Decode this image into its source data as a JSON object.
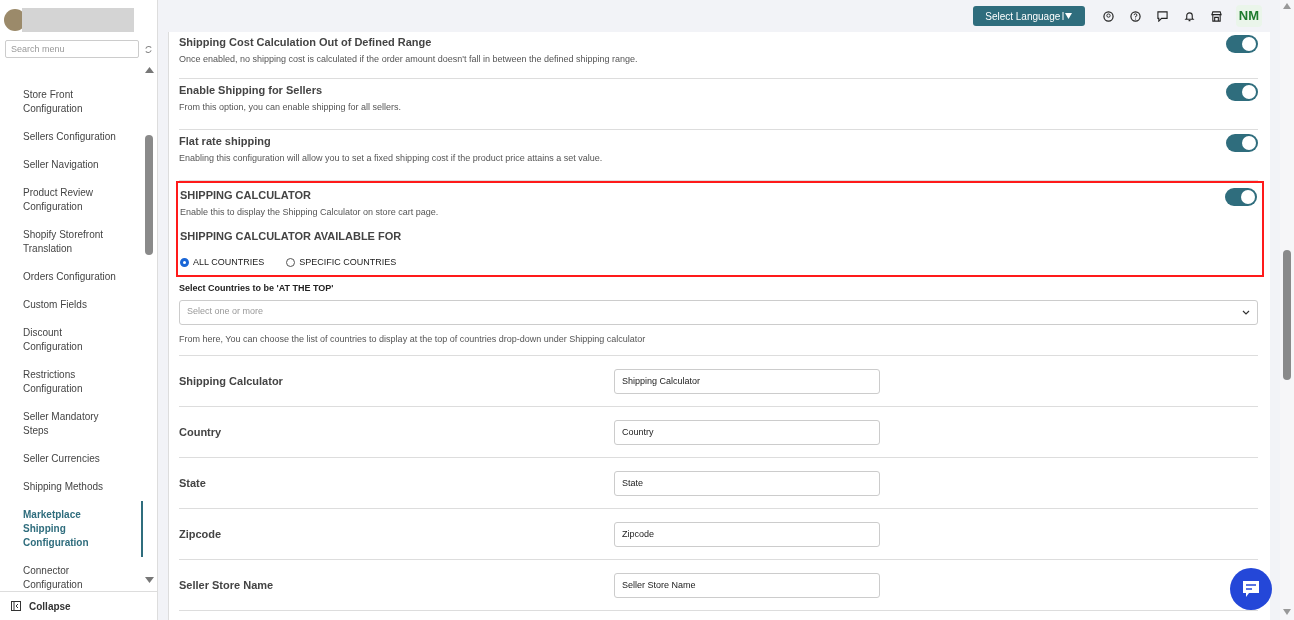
{
  "sidebar": {
    "search": {
      "placeholder": "Search menu"
    },
    "items": [
      {
        "label": "Store Front\nConfiguration",
        "selected": false
      },
      {
        "label": "Sellers Configuration",
        "selected": false
      },
      {
        "label": "Seller Navigation",
        "selected": false
      },
      {
        "label": "Product Review\nConfiguration",
        "selected": false
      },
      {
        "label": "Shopify Storefront\nTranslation",
        "selected": false
      },
      {
        "label": "Orders Configuration",
        "selected": false
      },
      {
        "label": "Custom Fields",
        "selected": false
      },
      {
        "label": "Discount\nConfiguration",
        "selected": false
      },
      {
        "label": "Restrictions\nConfiguration",
        "selected": false
      },
      {
        "label": "Seller Mandatory\nSteps",
        "selected": false
      },
      {
        "label": "Seller Currencies",
        "selected": false
      },
      {
        "label": "Shipping Methods",
        "selected": false
      },
      {
        "label": "Marketplace\nShipping\nConfiguration",
        "selected": true
      },
      {
        "label": "Connector\nConfiguration",
        "selected": false
      }
    ],
    "collapse": "Collapse"
  },
  "topbar": {
    "language_button": "Select Language",
    "avatar": "NM"
  },
  "settings": [
    {
      "title": "Shipping Cost Calculation Out of Defined Range",
      "description": "Once enabled, no shipping cost is calculated if the order amount doesn't fall in between the defined shipping range.",
      "on": true
    },
    {
      "title": "Enable Shipping for Sellers",
      "description": "From this option, you can enable shipping for all sellers.",
      "on": true
    },
    {
      "title": "Flat rate shipping",
      "description": "Enabling this configuration will allow you to set a fixed shipping cost if the product price attains a set value.",
      "on": true
    }
  ],
  "shipping_calculator": {
    "title": "SHIPPING CALCULATOR",
    "description": "Enable this to display the Shipping Calculator on store cart page.",
    "on": true,
    "highlighted": true,
    "available_for": "SHIPPING CALCULATOR AVAILABLE FOR",
    "options": [
      {
        "label": "ALL COUNTRIES",
        "selected": true
      },
      {
        "label": "SPECIFIC COUNTRIES",
        "selected": false
      }
    ]
  },
  "top_countries": {
    "label": "Select Countries to be 'AT THE TOP'",
    "placeholder": "Select one or more",
    "help": "From here, You can choose the list of countries to display at the top of countries drop-down under Shipping calculator"
  },
  "fields": [
    {
      "label": "Shipping Calculator",
      "value": "Shipping Calculator"
    },
    {
      "label": "Country",
      "value": "Country"
    },
    {
      "label": "State",
      "value": "State"
    },
    {
      "label": "Zipcode",
      "value": "Zipcode"
    },
    {
      "label": "Seller Store Name",
      "value": "Seller Store Name"
    }
  ]
}
